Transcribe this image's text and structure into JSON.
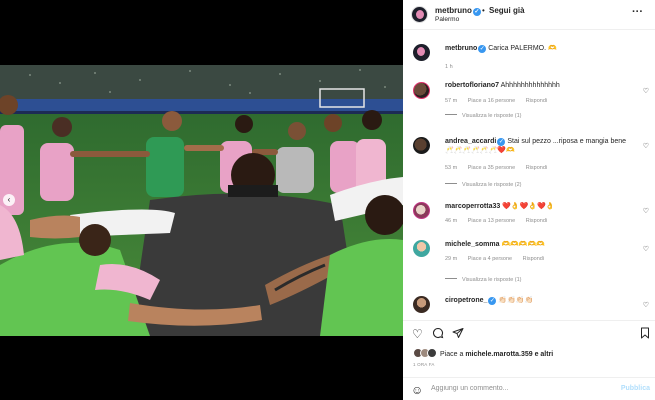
{
  "post": {
    "username": "metbruno",
    "follow_label": "Segui già",
    "location": "Palermo",
    "caption": "Carica PALERMO. 🫶",
    "caption_time": "1 h",
    "colors": {
      "verified": "#3897f0",
      "link_disabled": "#b2dffc",
      "muted": "#8e8e8e"
    }
  },
  "comments": [
    {
      "user": "robertofloriano7",
      "text": "Ahhhhhhhhhhhhhh",
      "time": "57 m",
      "likes": "Piace a 16 persone",
      "reply": "Rispondi",
      "view_replies": "Visualizza le risposte (1)"
    },
    {
      "user": "andrea_accardi",
      "text": "Stai sul pezzo ...riposa e mangia bene 🥂🥂🥂🥂🥂🥂❤️🫶",
      "time": "53 m",
      "likes": "Piace a 35 persone",
      "reply": "Rispondi",
      "view_replies": "Visualizza le risposte (2)"
    },
    {
      "user": "marcoperrotta33",
      "text": "❤️👌❤️👌❤️👌",
      "time": "46 m",
      "likes": "Piace a 13 persone",
      "reply": "Rispondi",
      "view_replies": ""
    },
    {
      "user": "michele_somma",
      "text": "🫶🫶🫶🫶🫶",
      "time": "29 m",
      "likes": "Piace a 4 persone",
      "reply": "Rispondi",
      "view_replies": "Visualizza le risposte (1)"
    },
    {
      "user": "ciropetrone_",
      "text": "👏🏻👏🏻👏🏻👏🏻",
      "time": "",
      "likes": "",
      "reply": "",
      "view_replies": ""
    }
  ],
  "engagement": {
    "liked_prefix": "Piace a",
    "liked_user": "michele.marotta.359",
    "liked_suffix": "e altri",
    "date": "1 ORA FA"
  },
  "composer": {
    "placeholder": "Aggiungi un commento...",
    "publish_label": "Pubblica"
  },
  "icons": [
    "heart-icon",
    "comment-icon",
    "share-icon",
    "bookmark-icon",
    "emoji-icon",
    "more-icon",
    "chevron-left-icon",
    "verified-icon"
  ]
}
